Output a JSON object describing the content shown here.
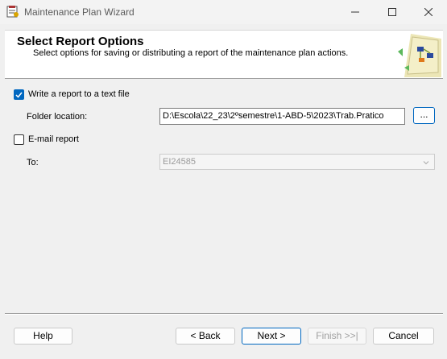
{
  "window": {
    "title": "Maintenance Plan Wizard",
    "minimize_icon": "minimize-icon",
    "maximize_icon": "maximize-icon",
    "close_icon": "close-icon"
  },
  "header": {
    "title": "Select Report Options",
    "subtitle": "Select options for saving or distributing a report of the maintenance plan actions.",
    "art_icon": "wizard-banner-icon"
  },
  "report_to_file": {
    "label": "Write a report to a text file",
    "checked": true,
    "folder_label": "Folder location:",
    "folder_value": "D:\\Escola\\22_23\\2ºsemestre\\1-ABD-5\\2023\\Trab.Pratico",
    "browse_label": "..."
  },
  "email_report": {
    "label": "E-mail report",
    "checked": false,
    "to_label": "To:",
    "to_value": "EI24585"
  },
  "buttons": {
    "help": "Help",
    "back": "< Back",
    "next": "Next >",
    "finish": "Finish >>|",
    "cancel": "Cancel"
  },
  "colors": {
    "accent": "#0067c0",
    "background": "#f0f0f0"
  }
}
